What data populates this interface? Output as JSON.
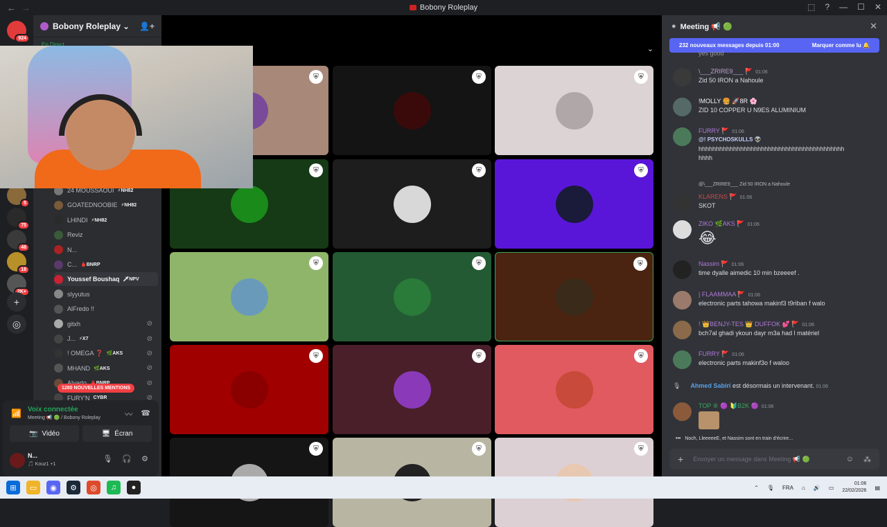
{
  "window": {
    "title": "Bobony Roleplay"
  },
  "guilds": [
    {
      "badge": "924",
      "color": "#e23b3b"
    },
    {
      "badge": "5",
      "color": "#8a6a3a"
    },
    {
      "badge": "75",
      "color": "#2a2a2a"
    },
    {
      "badge": "48",
      "color": "#3a3a3a"
    },
    {
      "badge": "18",
      "color": "#b8902a"
    },
    {
      "badge": "2K+",
      "color": "#555555"
    }
  ],
  "server": {
    "name": "Bobony Roleplay",
    "live_label": "En Direct"
  },
  "members": [
    {
      "name": "24 MOUSSAOUI",
      "tag": "⚡NH82",
      "color": "#777"
    },
    {
      "name": "GOATEDNOOBIE",
      "tag": "⚡NH82",
      "color": "#7a5a3a"
    },
    {
      "name": "LHINDI",
      "tag": "⚡NH82",
      "color": "#2a2a2a"
    },
    {
      "name": "Reviz",
      "tag": "",
      "color": "#3a5a3a"
    },
    {
      "name": "N...",
      "tag": "",
      "color": "#a22"
    },
    {
      "name": "C...",
      "tag": "🩸BNRP",
      "color": "#5a3a6a"
    },
    {
      "name": "Youssef Boushaq",
      "tag": "🗡NPV",
      "color": "#c23"
    },
    {
      "name": "slyyutus",
      "tag": "",
      "color": "#888"
    },
    {
      "name": "AlFredo !!",
      "tag": "",
      "color": "#555"
    },
    {
      "name": "gitxh",
      "tag": "",
      "color": "#aaa"
    },
    {
      "name": "J...",
      "tag": "⚡X7",
      "color": "#444"
    },
    {
      "name": "! OMEGA ❓",
      "tag": "🌿AKS",
      "color": "#333"
    },
    {
      "name": "MHAND",
      "tag": "🌿AKS",
      "color": "#555"
    },
    {
      "name": "Alvarto",
      "tag": "🩸BNRP",
      "color": "#6a4a3a"
    },
    {
      "name": "FURY'N",
      "tag": "CYBR",
      "color": "#444"
    }
  ],
  "mentions_badge": "1280 NOUVELLES MENTIONS",
  "voice": {
    "status": "Voix connectée",
    "channel": "Meeting 📢 🟢 / Bobony Roleplay",
    "video_label": "Vidéo",
    "screen_label": "Écran"
  },
  "user": {
    "name": "N...",
    "status": "🎵 Kouz1 +1"
  },
  "tiles": [
    {
      "bg": "#a88878",
      "av": "#7a4a9a"
    },
    {
      "bg": "#141414",
      "av": "#3a0a0a"
    },
    {
      "bg": "#dcd4d4",
      "av": "#b0a8a8"
    },
    {
      "bg": "#153a15",
      "av": "#1a8a1a"
    },
    {
      "bg": "#1d1d1d",
      "av": "#d8d8d8"
    },
    {
      "bg": "#5a16d8",
      "av": "#1a1a3a"
    },
    {
      "bg": "#8fb56a",
      "av": "#6a9aba"
    },
    {
      "bg": "#235a33",
      "av": "#2a7a3a"
    },
    {
      "bg": "#4a2410",
      "av": "#3a2a1a"
    },
    {
      "bg": "#a10000",
      "av": "#8a0000"
    },
    {
      "bg": "#4a1f2a",
      "av": "#8a3ab8"
    },
    {
      "bg": "#e05a60",
      "av": "#c84a3a"
    },
    {
      "bg": "#151515",
      "av": "#aaa"
    },
    {
      "bg": "#b8b6a2",
      "av": "#222"
    },
    {
      "bg": "#dcd0d4",
      "av": "#e8c8b0"
    }
  ],
  "chat": {
    "channel": "Meeting 📢 🟢",
    "new_messages": "232 nouveaux messages depuis 01:00",
    "mark_read": "Marquer comme lu 🔔",
    "partial_top": "yes good",
    "messages": [
      {
        "author": "\\___ZRIRE9___ 🚩",
        "time": "01:06",
        "text": "Zid 50 IRON a Nahoule",
        "color": "#c0a0d0",
        "av": "#3a3a3a"
      },
      {
        "author": "!MOLLY 🍔 🚀8R 🌸",
        "time": "",
        "text": "ZID 10 COPPER  U N9ES ALUMINIUM",
        "color": "#f2f3f5",
        "av": "#556a66"
      },
      {
        "author": "FURRY 🚩",
        "time": "01:06",
        "text": "@! PSYCHOSKULLS 👽",
        "text2": "hhhhhhhhhhhhhhhhhhhhhhhhhhhhhhhhhhhhhhhhhh",
        "text3": "hhhh",
        "color": "#b07ad8",
        "av": "#4a7a5a"
      },
      {
        "author": "KLARENS 🚩",
        "time": "01:06",
        "text": "SKOT",
        "reply": "@\\___ZRIRE9___ Zid 50 IRON a Nahoule",
        "color": "#c94a4a",
        "av": "#333"
      },
      {
        "author": "ZIKO 🌿AKS 🚩",
        "time": "01:06",
        "text": "😂",
        "color": "#b07ad8",
        "av": "#ddd"
      },
      {
        "author": "Nassim 🚩",
        "time": "01:06",
        "text": "time dyalle aimedic 10 min bzeeeef .",
        "color": "#b07ad8",
        "av": "#222"
      },
      {
        "author": "| FLAAMMAA 🚩",
        "time": "01:06",
        "text": "electronic parts tahowa makinf3 t9riban f walo",
        "color": "#b07ad8",
        "av": "#9a7a6a"
      },
      {
        "author": "! 👑BENJY-TES 👑 DUFFOK 💕 🚩",
        "time": "01:06",
        "text": "bch7al ghadi ykoun dayr m3a had l matériel",
        "color": "#b07ad8",
        "av": "#8a6a4a"
      },
      {
        "author": "FURRY 🚩",
        "time": "01:06",
        "text": "electronic parts makinf3o f waloo",
        "color": "#b07ad8",
        "av": "#4a7a5a"
      }
    ],
    "system": {
      "name": "Ahmed Sabiri",
      "text": "est désormais un intervenant.",
      "time": "01:06"
    },
    "last": {
      "author": "TOP ⑥ 🟣 🔰B2K 🟣",
      "time": "01:06",
      "color": "#3ba55d",
      "av": "#8a5a3a"
    },
    "typing": "Noch, LleeeeeE, et Nassim sont en train d'écrire...",
    "placeholder": "Envoyer un message dans Meeting 📢 🟢"
  },
  "taskbar": {
    "lang": "FRA",
    "time": "01:06",
    "date": "22/02/2026"
  }
}
